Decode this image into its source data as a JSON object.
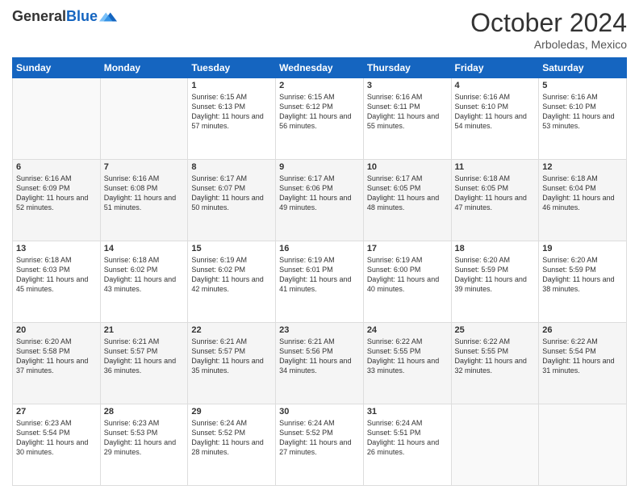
{
  "header": {
    "logo_general": "General",
    "logo_blue": "Blue",
    "month_title": "October 2024",
    "subtitle": "Arboledas, Mexico"
  },
  "days_of_week": [
    "Sunday",
    "Monday",
    "Tuesday",
    "Wednesday",
    "Thursday",
    "Friday",
    "Saturday"
  ],
  "weeks": [
    [
      {
        "day": "",
        "info": ""
      },
      {
        "day": "",
        "info": ""
      },
      {
        "day": "1",
        "info": "Sunrise: 6:15 AM\nSunset: 6:13 PM\nDaylight: 11 hours and 57 minutes."
      },
      {
        "day": "2",
        "info": "Sunrise: 6:15 AM\nSunset: 6:12 PM\nDaylight: 11 hours and 56 minutes."
      },
      {
        "day": "3",
        "info": "Sunrise: 6:16 AM\nSunset: 6:11 PM\nDaylight: 11 hours and 55 minutes."
      },
      {
        "day": "4",
        "info": "Sunrise: 6:16 AM\nSunset: 6:10 PM\nDaylight: 11 hours and 54 minutes."
      },
      {
        "day": "5",
        "info": "Sunrise: 6:16 AM\nSunset: 6:10 PM\nDaylight: 11 hours and 53 minutes."
      }
    ],
    [
      {
        "day": "6",
        "info": "Sunrise: 6:16 AM\nSunset: 6:09 PM\nDaylight: 11 hours and 52 minutes."
      },
      {
        "day": "7",
        "info": "Sunrise: 6:16 AM\nSunset: 6:08 PM\nDaylight: 11 hours and 51 minutes."
      },
      {
        "day": "8",
        "info": "Sunrise: 6:17 AM\nSunset: 6:07 PM\nDaylight: 11 hours and 50 minutes."
      },
      {
        "day": "9",
        "info": "Sunrise: 6:17 AM\nSunset: 6:06 PM\nDaylight: 11 hours and 49 minutes."
      },
      {
        "day": "10",
        "info": "Sunrise: 6:17 AM\nSunset: 6:05 PM\nDaylight: 11 hours and 48 minutes."
      },
      {
        "day": "11",
        "info": "Sunrise: 6:18 AM\nSunset: 6:05 PM\nDaylight: 11 hours and 47 minutes."
      },
      {
        "day": "12",
        "info": "Sunrise: 6:18 AM\nSunset: 6:04 PM\nDaylight: 11 hours and 46 minutes."
      }
    ],
    [
      {
        "day": "13",
        "info": "Sunrise: 6:18 AM\nSunset: 6:03 PM\nDaylight: 11 hours and 45 minutes."
      },
      {
        "day": "14",
        "info": "Sunrise: 6:18 AM\nSunset: 6:02 PM\nDaylight: 11 hours and 43 minutes."
      },
      {
        "day": "15",
        "info": "Sunrise: 6:19 AM\nSunset: 6:02 PM\nDaylight: 11 hours and 42 minutes."
      },
      {
        "day": "16",
        "info": "Sunrise: 6:19 AM\nSunset: 6:01 PM\nDaylight: 11 hours and 41 minutes."
      },
      {
        "day": "17",
        "info": "Sunrise: 6:19 AM\nSunset: 6:00 PM\nDaylight: 11 hours and 40 minutes."
      },
      {
        "day": "18",
        "info": "Sunrise: 6:20 AM\nSunset: 5:59 PM\nDaylight: 11 hours and 39 minutes."
      },
      {
        "day": "19",
        "info": "Sunrise: 6:20 AM\nSunset: 5:59 PM\nDaylight: 11 hours and 38 minutes."
      }
    ],
    [
      {
        "day": "20",
        "info": "Sunrise: 6:20 AM\nSunset: 5:58 PM\nDaylight: 11 hours and 37 minutes."
      },
      {
        "day": "21",
        "info": "Sunrise: 6:21 AM\nSunset: 5:57 PM\nDaylight: 11 hours and 36 minutes."
      },
      {
        "day": "22",
        "info": "Sunrise: 6:21 AM\nSunset: 5:57 PM\nDaylight: 11 hours and 35 minutes."
      },
      {
        "day": "23",
        "info": "Sunrise: 6:21 AM\nSunset: 5:56 PM\nDaylight: 11 hours and 34 minutes."
      },
      {
        "day": "24",
        "info": "Sunrise: 6:22 AM\nSunset: 5:55 PM\nDaylight: 11 hours and 33 minutes."
      },
      {
        "day": "25",
        "info": "Sunrise: 6:22 AM\nSunset: 5:55 PM\nDaylight: 11 hours and 32 minutes."
      },
      {
        "day": "26",
        "info": "Sunrise: 6:22 AM\nSunset: 5:54 PM\nDaylight: 11 hours and 31 minutes."
      }
    ],
    [
      {
        "day": "27",
        "info": "Sunrise: 6:23 AM\nSunset: 5:54 PM\nDaylight: 11 hours and 30 minutes."
      },
      {
        "day": "28",
        "info": "Sunrise: 6:23 AM\nSunset: 5:53 PM\nDaylight: 11 hours and 29 minutes."
      },
      {
        "day": "29",
        "info": "Sunrise: 6:24 AM\nSunset: 5:52 PM\nDaylight: 11 hours and 28 minutes."
      },
      {
        "day": "30",
        "info": "Sunrise: 6:24 AM\nSunset: 5:52 PM\nDaylight: 11 hours and 27 minutes."
      },
      {
        "day": "31",
        "info": "Sunrise: 6:24 AM\nSunset: 5:51 PM\nDaylight: 11 hours and 26 minutes."
      },
      {
        "day": "",
        "info": ""
      },
      {
        "day": "",
        "info": ""
      }
    ]
  ]
}
